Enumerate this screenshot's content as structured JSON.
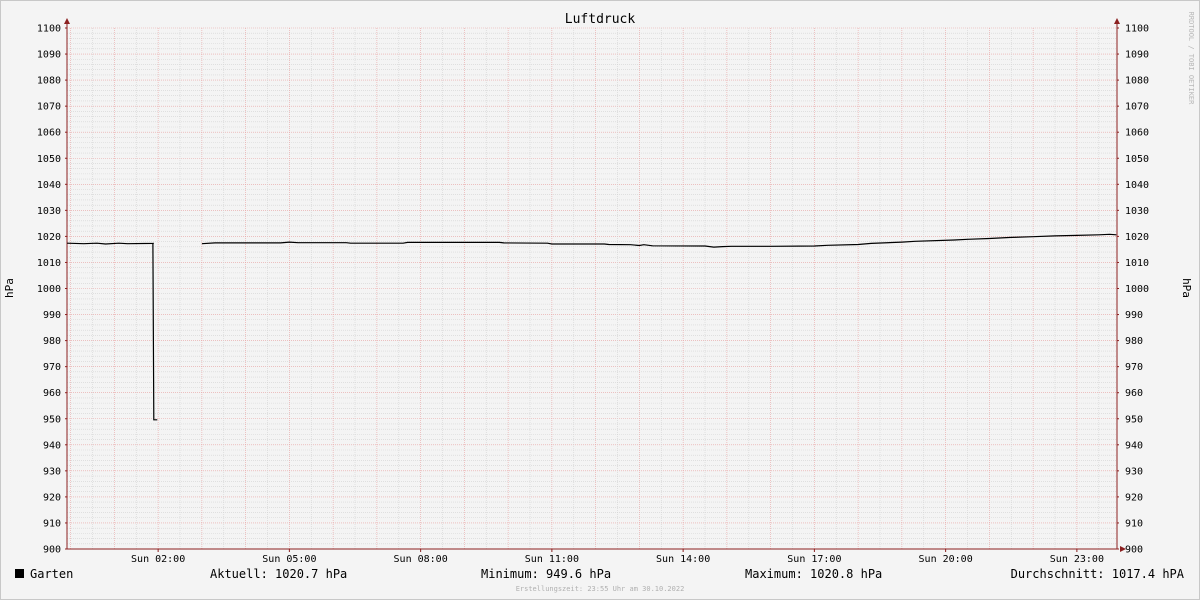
{
  "chart_data": {
    "type": "line",
    "title": "Luftdruck",
    "ylabel": "hPa",
    "ylabel_right": "hPa",
    "ylim": [
      900,
      1100
    ],
    "yticks": [
      900,
      910,
      920,
      930,
      940,
      950,
      960,
      970,
      980,
      990,
      1000,
      1010,
      1020,
      1030,
      1040,
      1050,
      1060,
      1070,
      1080,
      1090,
      1100
    ],
    "xlim_hours": [
      -0.083,
      23.917
    ],
    "xticks": [
      {
        "h": 2,
        "label": "Sun 02:00"
      },
      {
        "h": 5,
        "label": "Sun 05:00"
      },
      {
        "h": 8,
        "label": "Sun 08:00"
      },
      {
        "h": 11,
        "label": "Sun 11:00"
      },
      {
        "h": 14,
        "label": "Sun 14:00"
      },
      {
        "h": 17,
        "label": "Sun 17:00"
      },
      {
        "h": 20,
        "label": "Sun 20:00"
      },
      {
        "h": 23,
        "label": "Sun 23:00"
      }
    ],
    "series": [
      {
        "name": "Garten",
        "color": "#000000",
        "segments": [
          [
            [
              -0.08,
              1017.4
            ],
            [
              0.3,
              1017.2
            ],
            [
              0.6,
              1017.4
            ],
            [
              0.8,
              1017.1
            ],
            [
              1.1,
              1017.4
            ],
            [
              1.3,
              1017.2
            ],
            [
              1.9,
              1017.3
            ],
            [
              1.88,
              1017.3
            ]
          ],
          [
            [
              1.88,
              1017.3
            ],
            [
              1.9,
              949.6
            ],
            [
              1.98,
              949.6
            ]
          ],
          [
            [
              3.0,
              1017.2
            ],
            [
              3.3,
              1017.5
            ],
            [
              4.5,
              1017.5
            ],
            [
              4.8,
              1017.5
            ],
            [
              5.0,
              1017.8
            ],
            [
              5.2,
              1017.6
            ],
            [
              6.3,
              1017.6
            ],
            [
              6.4,
              1017.4
            ],
            [
              7.6,
              1017.4
            ],
            [
              7.7,
              1017.7
            ],
            [
              9.8,
              1017.7
            ],
            [
              9.9,
              1017.5
            ],
            [
              10.9,
              1017.4
            ],
            [
              11.0,
              1017.1
            ],
            [
              12.2,
              1017.1
            ],
            [
              12.3,
              1016.9
            ],
            [
              12.8,
              1016.8
            ],
            [
              13.0,
              1016.5
            ],
            [
              13.1,
              1016.8
            ],
            [
              13.3,
              1016.4
            ],
            [
              14.5,
              1016.3
            ],
            [
              14.7,
              1015.9
            ],
            [
              14.9,
              1016.1
            ],
            [
              15.1,
              1016.2
            ],
            [
              16.0,
              1016.2
            ],
            [
              17.0,
              1016.3
            ],
            [
              17.3,
              1016.6
            ],
            [
              18.0,
              1016.9
            ],
            [
              18.3,
              1017.3
            ],
            [
              19.0,
              1017.8
            ],
            [
              19.3,
              1018.1
            ],
            [
              20.2,
              1018.6
            ],
            [
              20.5,
              1018.9
            ],
            [
              21.0,
              1019.2
            ],
            [
              21.5,
              1019.6
            ],
            [
              22.0,
              1019.9
            ],
            [
              22.5,
              1020.2
            ],
            [
              23.0,
              1020.4
            ],
            [
              23.5,
              1020.6
            ],
            [
              23.75,
              1020.8
            ],
            [
              23.9,
              1020.6
            ]
          ]
        ]
      }
    ],
    "legend": {
      "series_name": "Garten",
      "current": "Aktuell: 1020.7 hPa",
      "minimum": "Minimum: 949.6 hPa",
      "maximum": "Maximum: 1020.8 hPa",
      "average": "Durchschnitt: 1017.4 hPA"
    },
    "watermark": "RRDTOOL / TOBI OETIKER",
    "footer": "Erstellungszeit: 23:55 Uhr am 30.10.2022",
    "colors": {
      "grid_minor": "#d2d2d2",
      "grid_major": "#e8a0a0",
      "axis": "#8b2020",
      "line": "#000000"
    }
  }
}
